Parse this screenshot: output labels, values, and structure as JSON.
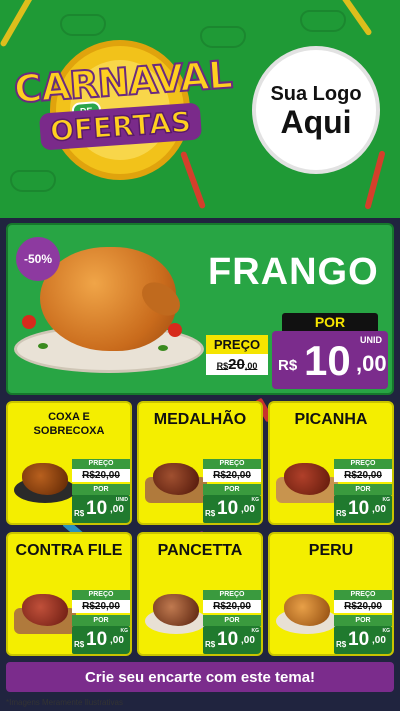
{
  "header": {
    "title_word1": "CARNAVAL",
    "title_de": "DE",
    "title_word2": "OFERTAS",
    "brand_line1": "Sua Logo",
    "brand_line2": "Aqui"
  },
  "hero": {
    "discount_badge": "-50%",
    "product_name": "FRANGO",
    "old_price_label": "PREÇO",
    "old_price_currency": "R$",
    "old_price_int": "20",
    "old_price_cents": ",00",
    "new_price_label": "POR",
    "new_price_currency": "R$",
    "new_price_int": "10",
    "new_price_cents": ",00",
    "unit": "UNID"
  },
  "products": [
    {
      "name": "COXA E SOBRECOXA",
      "old_label": "PREÇO",
      "old_price": "R$20,00",
      "new_label": "POR",
      "currency": "R$",
      "price_int": "10",
      "price_cents": ",00",
      "unit": "UNID"
    },
    {
      "name": "MEDALHÃO",
      "old_label": "PREÇO",
      "old_price": "R$20,00",
      "new_label": "POR",
      "currency": "R$",
      "price_int": "10",
      "price_cents": ",00",
      "unit": "KG"
    },
    {
      "name": "PICANHA",
      "old_label": "PREÇO",
      "old_price": "R$20,00",
      "new_label": "POR",
      "currency": "R$",
      "price_int": "10",
      "price_cents": ",00",
      "unit": "KG"
    },
    {
      "name": "CONTRA FILE",
      "old_label": "PREÇO",
      "old_price": "R$20,00",
      "new_label": "POR",
      "currency": "R$",
      "price_int": "10",
      "price_cents": ",00",
      "unit": "KG"
    },
    {
      "name": "PANCETTA",
      "old_label": "PREÇO",
      "old_price": "R$20,00",
      "new_label": "POR",
      "currency": "R$",
      "price_int": "10",
      "price_cents": ",00",
      "unit": "KG"
    },
    {
      "name": "PERU",
      "old_label": "PREÇO",
      "old_price": "R$20,00",
      "new_label": "POR",
      "currency": "R$",
      "price_int": "10",
      "price_cents": ",00",
      "unit": "KG"
    }
  ],
  "cta": {
    "label": "Crie seu encarte com este tema!"
  },
  "footnote": "*Imagens Meramente Ilustrativas",
  "colors": {
    "header_green": "#1f9a36",
    "hero_green": "#28a544",
    "card_yellow": "#f4ee00",
    "purple": "#7b2c8c",
    "dark_bg": "#20243f"
  }
}
